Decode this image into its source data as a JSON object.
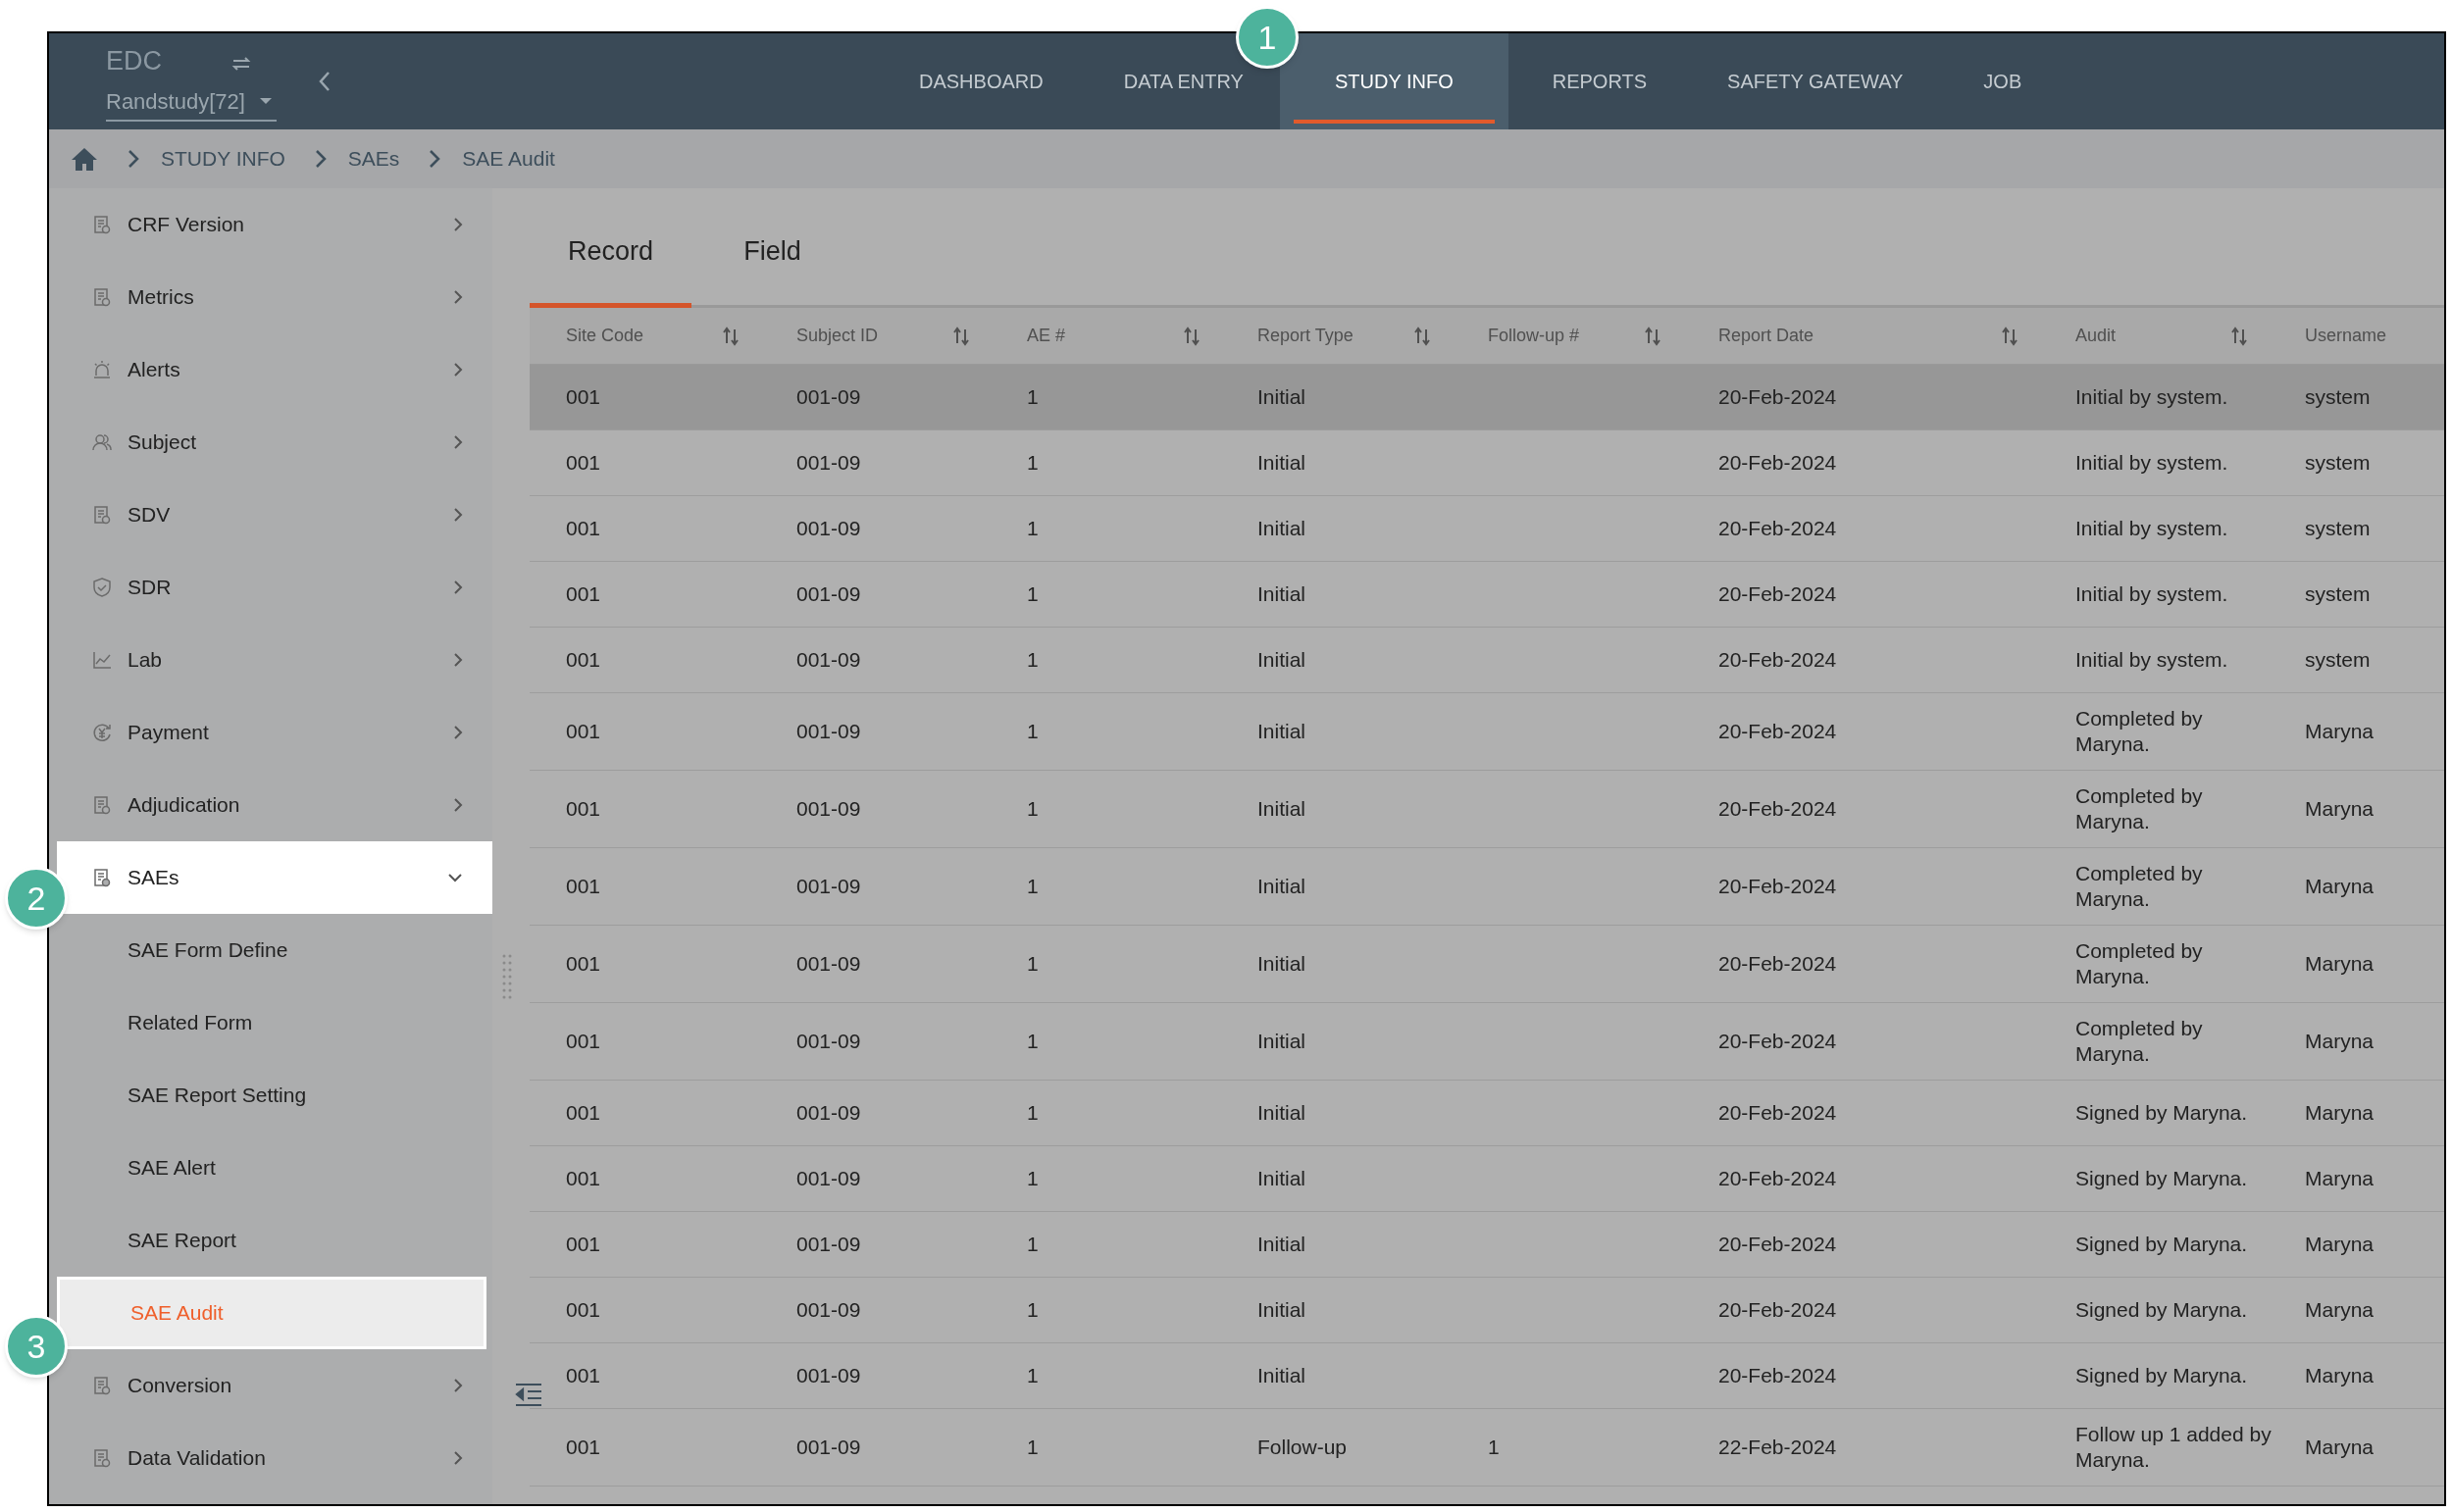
{
  "header": {
    "app_title": "EDC",
    "study": "Randstudy[72]",
    "nav": [
      {
        "label": "DASHBOARD",
        "selected": false,
        "highlighted": false
      },
      {
        "label": "DATA ENTRY",
        "selected": false,
        "highlighted": false
      },
      {
        "label": "STUDY INFO",
        "selected": true,
        "highlighted": true
      },
      {
        "label": "REPORTS",
        "selected": false,
        "highlighted": false
      },
      {
        "label": "SAFETY GATEWAY",
        "selected": false,
        "highlighted": false
      },
      {
        "label": "JOB",
        "selected": false,
        "highlighted": false
      }
    ]
  },
  "breadcrumb": [
    "STUDY INFO",
    "SAEs",
    "SAE Audit"
  ],
  "sidebar": {
    "items": [
      {
        "label": "CRF Version",
        "expanded": false,
        "highlighted": false
      },
      {
        "label": "Metrics",
        "expanded": false,
        "highlighted": false
      },
      {
        "label": "Alerts",
        "expanded": false,
        "highlighted": false
      },
      {
        "label": "Subject",
        "expanded": false,
        "highlighted": false
      },
      {
        "label": "SDV",
        "expanded": false,
        "highlighted": false
      },
      {
        "label": "SDR",
        "expanded": false,
        "highlighted": false
      },
      {
        "label": "Lab",
        "expanded": false,
        "highlighted": false
      },
      {
        "label": "Payment",
        "expanded": false,
        "highlighted": false
      },
      {
        "label": "Adjudication",
        "expanded": false,
        "highlighted": false
      },
      {
        "label": "SAEs",
        "expanded": true,
        "highlighted": true,
        "children": [
          {
            "label": "SAE Form Define",
            "selected": false,
            "highlighted": false
          },
          {
            "label": "Related Form",
            "selected": false,
            "highlighted": false
          },
          {
            "label": "SAE Report Setting",
            "selected": false,
            "highlighted": false
          },
          {
            "label": "SAE Alert",
            "selected": false,
            "highlighted": false
          },
          {
            "label": "SAE Report",
            "selected": false,
            "highlighted": false
          },
          {
            "label": "SAE Audit",
            "selected": true,
            "highlighted": true
          }
        ]
      },
      {
        "label": "Conversion",
        "expanded": false,
        "highlighted": false
      },
      {
        "label": "Data Validation",
        "expanded": false,
        "highlighted": false
      }
    ]
  },
  "tabs": [
    {
      "label": "Record",
      "selected": true
    },
    {
      "label": "Field",
      "selected": false
    }
  ],
  "table": {
    "columns": [
      {
        "label": "Site Code",
        "sortable": true
      },
      {
        "label": "Subject ID",
        "sortable": true
      },
      {
        "label": "AE #",
        "sortable": true
      },
      {
        "label": "Report Type",
        "sortable": true
      },
      {
        "label": "Follow-up #",
        "sortable": true
      },
      {
        "label": "Report Date",
        "sortable": true
      },
      {
        "label": "Audit",
        "sortable": true
      },
      {
        "label": "Username",
        "sortable": false
      }
    ],
    "rows": [
      {
        "hovered": true,
        "cells": [
          "001",
          "001-09",
          "1",
          "Initial",
          null,
          "20-Feb-2024",
          "Initial by system.",
          "system"
        ]
      },
      {
        "hovered": false,
        "cells": [
          "001",
          "001-09",
          "1",
          "Initial",
          null,
          "20-Feb-2024",
          "Initial by system.",
          "system"
        ]
      },
      {
        "hovered": false,
        "cells": [
          "001",
          "001-09",
          "1",
          "Initial",
          null,
          "20-Feb-2024",
          "Initial by system.",
          "system"
        ]
      },
      {
        "hovered": false,
        "cells": [
          "001",
          "001-09",
          "1",
          "Initial",
          null,
          "20-Feb-2024",
          "Initial by system.",
          "system"
        ]
      },
      {
        "hovered": false,
        "cells": [
          "001",
          "001-09",
          "1",
          "Initial",
          null,
          "20-Feb-2024",
          "Initial by system.",
          "system"
        ]
      },
      {
        "hovered": false,
        "cells": [
          "001",
          "001-09",
          "1",
          "Initial",
          null,
          "20-Feb-2024",
          "Completed by Maryna.",
          "Maryna"
        ]
      },
      {
        "hovered": false,
        "cells": [
          "001",
          "001-09",
          "1",
          "Initial",
          null,
          "20-Feb-2024",
          "Completed by Maryna.",
          "Maryna"
        ]
      },
      {
        "hovered": false,
        "cells": [
          "001",
          "001-09",
          "1",
          "Initial",
          null,
          "20-Feb-2024",
          "Completed by Maryna.",
          "Maryna"
        ]
      },
      {
        "hovered": false,
        "cells": [
          "001",
          "001-09",
          "1",
          "Initial",
          null,
          "20-Feb-2024",
          "Completed by Maryna.",
          "Maryna"
        ]
      },
      {
        "hovered": false,
        "cells": [
          "001",
          "001-09",
          "1",
          "Initial",
          null,
          "20-Feb-2024",
          "Completed by Maryna.",
          "Maryna"
        ]
      },
      {
        "hovered": false,
        "cells": [
          "001",
          "001-09",
          "1",
          "Initial",
          null,
          "20-Feb-2024",
          "Signed by Maryna.",
          "Maryna"
        ]
      },
      {
        "hovered": false,
        "cells": [
          "001",
          "001-09",
          "1",
          "Initial",
          null,
          "20-Feb-2024",
          "Signed by Maryna.",
          "Maryna"
        ]
      },
      {
        "hovered": false,
        "cells": [
          "001",
          "001-09",
          "1",
          "Initial",
          null,
          "20-Feb-2024",
          "Signed by Maryna.",
          "Maryna"
        ]
      },
      {
        "hovered": false,
        "cells": [
          "001",
          "001-09",
          "1",
          "Initial",
          null,
          "20-Feb-2024",
          "Signed by Maryna.",
          "Maryna"
        ]
      },
      {
        "hovered": false,
        "cells": [
          "001",
          "001-09",
          "1",
          "Initial",
          null,
          "20-Feb-2024",
          "Signed by Maryna.",
          "Maryna"
        ]
      },
      {
        "hovered": false,
        "cells": [
          "001",
          "001-09",
          "1",
          "Follow-up",
          "1",
          "22-Feb-2024",
          "Follow up 1 added by Maryna.",
          "Maryna"
        ]
      }
    ]
  },
  "callouts": [
    "1",
    "2",
    "3"
  ]
}
